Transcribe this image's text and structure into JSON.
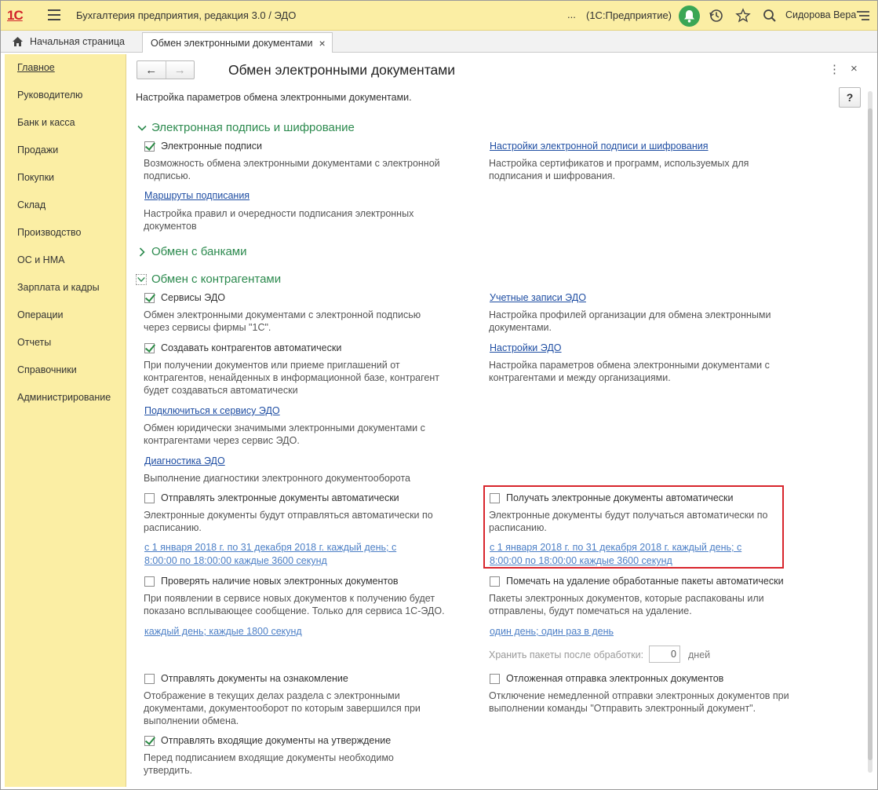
{
  "app": {
    "logo": "1С",
    "title": "Бухгалтерия предприятия, редакция 3.0 / ЭДО",
    "ellipsis": "...",
    "platform": "(1С:Предприятие)",
    "user": "Сидорова Вера"
  },
  "tabs": {
    "home": "Начальная страница",
    "active": "Обмен электронными документами",
    "close": "×"
  },
  "sidebar": {
    "items": [
      "Главное",
      "Руководителю",
      "Банк и касса",
      "Продажи",
      "Покупки",
      "Склад",
      "Производство",
      "ОС и НМА",
      "Зарплата и кадры",
      "Операции",
      "Отчеты",
      "Справочники",
      "Администрирование"
    ]
  },
  "page": {
    "title": "Обмен электронными документами",
    "subtitle": "Настройка параметров обмена электронными документами.",
    "help": "?",
    "kebab": "⋮",
    "close": "×"
  },
  "sections": {
    "sign": {
      "title": "Электронная подпись и шифрование",
      "cb_signatures": "Электронные подписи",
      "cb_signatures_desc": [
        "Возможность обмена электронными документами с электронной",
        "подписью."
      ],
      "routes_link": "Маршруты подписания",
      "routes_desc": [
        "Настройка правил и очередности подписания электронных",
        "документов"
      ],
      "settings_link": "Настройки электронной подписи и шифрования",
      "settings_desc": [
        "Настройка сертификатов и программ, используемых для",
        "подписания и шифрования."
      ]
    },
    "banks": {
      "title": "Обмен с банками"
    },
    "partners": {
      "title": "Обмен с контрагентами",
      "cb_services": "Сервисы ЭДО",
      "cb_services_desc": [
        "Обмен электронными документами с электронной подписью",
        "через сервисы фирмы \"1С\"."
      ],
      "accounts_link": "Учетные записи ЭДО",
      "accounts_desc": [
        "Настройка профилей организации для обмена электронными",
        "документами."
      ],
      "cb_auto_partners": "Создавать контрагентов автоматически",
      "cb_auto_partners_desc": [
        "При получении документов или приеме приглашений от",
        "контрагентов, ненайденных в информационной базе, контрагент",
        "будет создаваться автоматически"
      ],
      "edo_settings_link": "Настройки ЭДО",
      "edo_settings_desc": [
        "Настройка параметров обмена электронными документами с",
        "контрагентами и между организациями."
      ],
      "connect_link": "Подключиться к сервису ЭДО",
      "connect_desc": [
        "Обмен юридически значимыми электронными документами с",
        "контрагентами через сервис ЭДО."
      ],
      "diag_link": "Диагностика ЭДО",
      "diag_desc": [
        "Выполнение диагностики электронного документооборота"
      ],
      "cb_send_auto": "Отправлять электронные документы автоматически",
      "cb_send_auto_desc": [
        "Электронные документы будут отправляться автоматически по",
        "расписанию."
      ],
      "send_schedule": [
        "с 1 января 2018 г. по 31 декабря 2018 г. каждый день; с",
        "8:00:00 по 18:00:00 каждые 3600 секунд"
      ],
      "cb_receive_auto": "Получать электронные документы автоматически",
      "cb_receive_auto_desc": [
        "Электронные документы будут получаться автоматически по",
        "расписанию."
      ],
      "receive_schedule": [
        "с 1 января 2018 г. по 31 декабря 2018 г. каждый день; с",
        "8:00:00 по 18:00:00 каждые 3600 секунд"
      ],
      "cb_check_new": "Проверять наличие новых электронных документов",
      "cb_check_new_desc": [
        "При появлении в сервисе новых документов к получению будет",
        "показано всплывающее сообщение. Только для сервиса 1С-ЭДО."
      ],
      "check_schedule": "каждый день; каждые 1800 секунд",
      "cb_mark_delete": "Помечать на удаление обработанные пакеты автоматически",
      "cb_mark_delete_desc": [
        "Пакеты электронных документов, которые распакованы или",
        "отправлены, будут помечаться на удаление."
      ],
      "mark_schedule": "один день; один раз в день",
      "keep_label": "Хранить пакеты после обработки:",
      "keep_value": "0",
      "keep_unit": "дней",
      "cb_send_review": "Отправлять документы на ознакомление",
      "cb_send_review_desc": [
        "Отображение в текущих делах  раздела с электронными",
        "документами, документооборот по которым завершился при",
        "выполнении обмена."
      ],
      "cb_deferred": "Отложенная отправка электронных документов",
      "cb_deferred_desc": [
        "Отключение немедленной отправки электронных документов при",
        "выполнении команды \"Отправить электронный документ\"."
      ],
      "cb_incoming_approve": "Отправлять входящие документы на утверждение",
      "cb_incoming_approve_desc": [
        "Перед подписанием входящие документы необходимо",
        "утвердить."
      ]
    }
  },
  "checkbox_state": {
    "signatures": true,
    "services": true,
    "auto_partners": true,
    "send_auto": false,
    "receive_auto": false,
    "check_new": false,
    "mark_delete": false,
    "send_review": false,
    "deferred": false,
    "incoming_approve": true
  },
  "colors": {
    "accent_yellow": "#fbeea4",
    "section_green": "#2c8a4e",
    "link_blue": "#1f4ea3",
    "highlight_red": "#d8252c"
  }
}
